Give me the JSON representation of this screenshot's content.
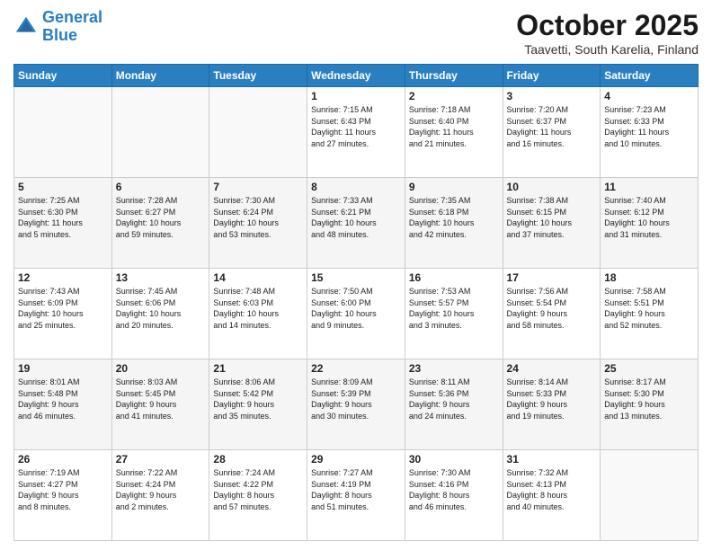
{
  "header": {
    "logo_line1": "General",
    "logo_line2": "Blue",
    "month": "October 2025",
    "location": "Taavetti, South Karelia, Finland"
  },
  "days_of_week": [
    "Sunday",
    "Monday",
    "Tuesday",
    "Wednesday",
    "Thursday",
    "Friday",
    "Saturday"
  ],
  "weeks": [
    [
      {
        "day": "",
        "info": ""
      },
      {
        "day": "",
        "info": ""
      },
      {
        "day": "",
        "info": ""
      },
      {
        "day": "1",
        "info": "Sunrise: 7:15 AM\nSunset: 6:43 PM\nDaylight: 11 hours\nand 27 minutes."
      },
      {
        "day": "2",
        "info": "Sunrise: 7:18 AM\nSunset: 6:40 PM\nDaylight: 11 hours\nand 21 minutes."
      },
      {
        "day": "3",
        "info": "Sunrise: 7:20 AM\nSunset: 6:37 PM\nDaylight: 11 hours\nand 16 minutes."
      },
      {
        "day": "4",
        "info": "Sunrise: 7:23 AM\nSunset: 6:33 PM\nDaylight: 11 hours\nand 10 minutes."
      }
    ],
    [
      {
        "day": "5",
        "info": "Sunrise: 7:25 AM\nSunset: 6:30 PM\nDaylight: 11 hours\nand 5 minutes."
      },
      {
        "day": "6",
        "info": "Sunrise: 7:28 AM\nSunset: 6:27 PM\nDaylight: 10 hours\nand 59 minutes."
      },
      {
        "day": "7",
        "info": "Sunrise: 7:30 AM\nSunset: 6:24 PM\nDaylight: 10 hours\nand 53 minutes."
      },
      {
        "day": "8",
        "info": "Sunrise: 7:33 AM\nSunset: 6:21 PM\nDaylight: 10 hours\nand 48 minutes."
      },
      {
        "day": "9",
        "info": "Sunrise: 7:35 AM\nSunset: 6:18 PM\nDaylight: 10 hours\nand 42 minutes."
      },
      {
        "day": "10",
        "info": "Sunrise: 7:38 AM\nSunset: 6:15 PM\nDaylight: 10 hours\nand 37 minutes."
      },
      {
        "day": "11",
        "info": "Sunrise: 7:40 AM\nSunset: 6:12 PM\nDaylight: 10 hours\nand 31 minutes."
      }
    ],
    [
      {
        "day": "12",
        "info": "Sunrise: 7:43 AM\nSunset: 6:09 PM\nDaylight: 10 hours\nand 25 minutes."
      },
      {
        "day": "13",
        "info": "Sunrise: 7:45 AM\nSunset: 6:06 PM\nDaylight: 10 hours\nand 20 minutes."
      },
      {
        "day": "14",
        "info": "Sunrise: 7:48 AM\nSunset: 6:03 PM\nDaylight: 10 hours\nand 14 minutes."
      },
      {
        "day": "15",
        "info": "Sunrise: 7:50 AM\nSunset: 6:00 PM\nDaylight: 10 hours\nand 9 minutes."
      },
      {
        "day": "16",
        "info": "Sunrise: 7:53 AM\nSunset: 5:57 PM\nDaylight: 10 hours\nand 3 minutes."
      },
      {
        "day": "17",
        "info": "Sunrise: 7:56 AM\nSunset: 5:54 PM\nDaylight: 9 hours\nand 58 minutes."
      },
      {
        "day": "18",
        "info": "Sunrise: 7:58 AM\nSunset: 5:51 PM\nDaylight: 9 hours\nand 52 minutes."
      }
    ],
    [
      {
        "day": "19",
        "info": "Sunrise: 8:01 AM\nSunset: 5:48 PM\nDaylight: 9 hours\nand 46 minutes."
      },
      {
        "day": "20",
        "info": "Sunrise: 8:03 AM\nSunset: 5:45 PM\nDaylight: 9 hours\nand 41 minutes."
      },
      {
        "day": "21",
        "info": "Sunrise: 8:06 AM\nSunset: 5:42 PM\nDaylight: 9 hours\nand 35 minutes."
      },
      {
        "day": "22",
        "info": "Sunrise: 8:09 AM\nSunset: 5:39 PM\nDaylight: 9 hours\nand 30 minutes."
      },
      {
        "day": "23",
        "info": "Sunrise: 8:11 AM\nSunset: 5:36 PM\nDaylight: 9 hours\nand 24 minutes."
      },
      {
        "day": "24",
        "info": "Sunrise: 8:14 AM\nSunset: 5:33 PM\nDaylight: 9 hours\nand 19 minutes."
      },
      {
        "day": "25",
        "info": "Sunrise: 8:17 AM\nSunset: 5:30 PM\nDaylight: 9 hours\nand 13 minutes."
      }
    ],
    [
      {
        "day": "26",
        "info": "Sunrise: 7:19 AM\nSunset: 4:27 PM\nDaylight: 9 hours\nand 8 minutes."
      },
      {
        "day": "27",
        "info": "Sunrise: 7:22 AM\nSunset: 4:24 PM\nDaylight: 9 hours\nand 2 minutes."
      },
      {
        "day": "28",
        "info": "Sunrise: 7:24 AM\nSunset: 4:22 PM\nDaylight: 8 hours\nand 57 minutes."
      },
      {
        "day": "29",
        "info": "Sunrise: 7:27 AM\nSunset: 4:19 PM\nDaylight: 8 hours\nand 51 minutes."
      },
      {
        "day": "30",
        "info": "Sunrise: 7:30 AM\nSunset: 4:16 PM\nDaylight: 8 hours\nand 46 minutes."
      },
      {
        "day": "31",
        "info": "Sunrise: 7:32 AM\nSunset: 4:13 PM\nDaylight: 8 hours\nand 40 minutes."
      },
      {
        "day": "",
        "info": ""
      }
    ]
  ]
}
